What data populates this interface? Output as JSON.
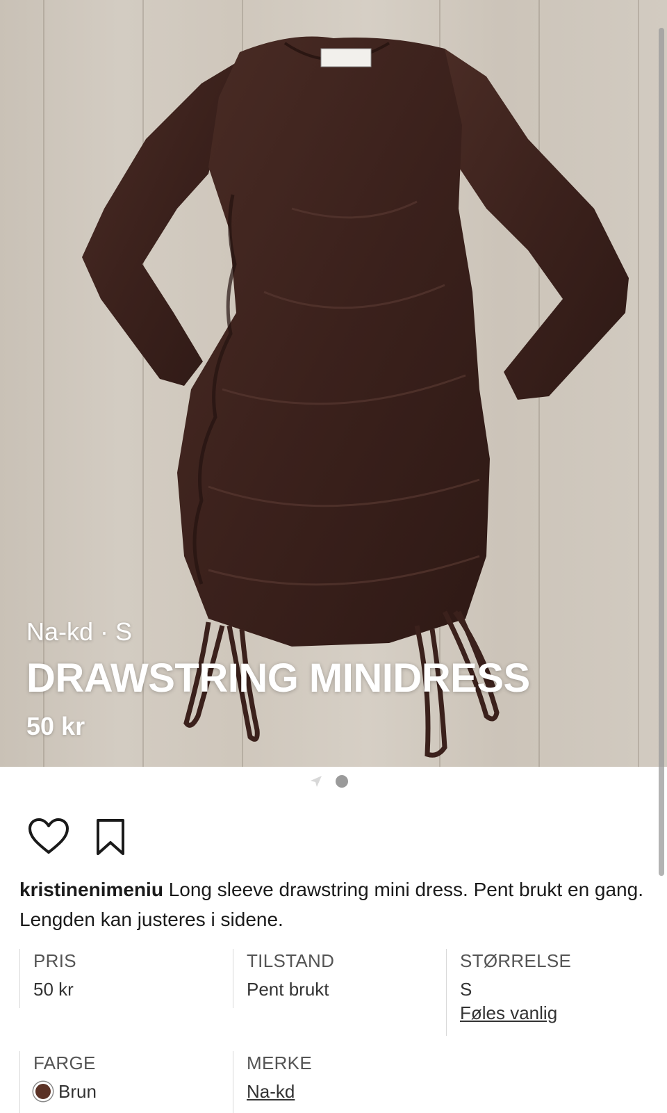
{
  "listing": {
    "brand_size": "Na-kd · S",
    "title": "DRAWSTRING MINIDRESS",
    "price": "50 kr"
  },
  "actions": {
    "like_icon": "heart-icon",
    "save_icon": "bookmark-icon"
  },
  "description": {
    "username": "kristinenimeniu",
    "text": " Long sleeve drawstring mini dress. Pent brukt en gang. Lengden kan justeres i sidene."
  },
  "details": {
    "price_label": "PRIS",
    "price_value": "50 kr",
    "condition_label": "TILSTAND",
    "condition_value": "Pent brukt",
    "size_label": "STØRRELSE",
    "size_value": "S",
    "size_fit": "Føles vanlig",
    "color_label": "FARGE",
    "color_value": "Brun",
    "color_hex": "#5b3226",
    "brand_label": "MERKE",
    "brand_value": "Na-kd"
  },
  "colors": {
    "dress": "#3b211c",
    "floor": "#cfc7bc"
  }
}
